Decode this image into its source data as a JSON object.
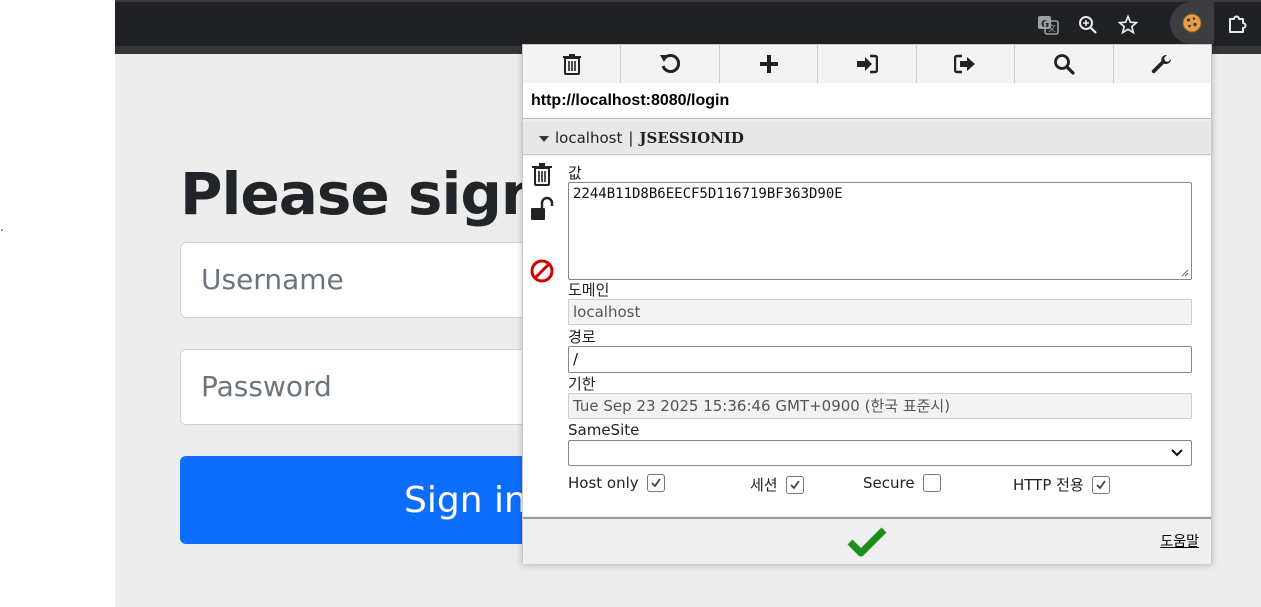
{
  "browser": {
    "toolbar_icons": [
      "translate-icon",
      "zoom-icon",
      "star-icon",
      "cookie-extension-icon",
      "extensions-puzzle-icon"
    ]
  },
  "page": {
    "stray_text": ".",
    "title": "Please sign in",
    "username_placeholder": "Username",
    "password_placeholder": "Password",
    "signin_label": "Sign in",
    "button_color": "#0d6efd"
  },
  "popup": {
    "toolbar": [
      "delete-all-icon",
      "reset-icon",
      "add-icon",
      "import-icon",
      "export-icon",
      "search-icon",
      "options-wrench-icon"
    ],
    "url": "http://localhost:8080/login",
    "cookie_host": "localhost",
    "cookie_sep": "|",
    "cookie_name": "JSESSIONID",
    "fields": {
      "value_label": "값",
      "value": "2244B11D8B6EECF5D116719BF363D90E",
      "domain_label": "도메인",
      "domain": "localhost",
      "path_label": "경로",
      "path": "/",
      "expiry_label": "기한",
      "expiry": "Tue Sep 23 2025 15:36:46 GMT+0900 (한국 표준시)",
      "samesite_label": "SameSite",
      "samesite_value": ""
    },
    "flags": {
      "host_only_label": "Host only",
      "host_only": true,
      "session_label": "세션",
      "session": true,
      "secure_label": "Secure",
      "secure": false,
      "http_only_label": "HTTP 전용",
      "http_only": true
    },
    "help_label": "도움말",
    "accent_green": "#1a8f1a",
    "block_red": "#d00000"
  }
}
